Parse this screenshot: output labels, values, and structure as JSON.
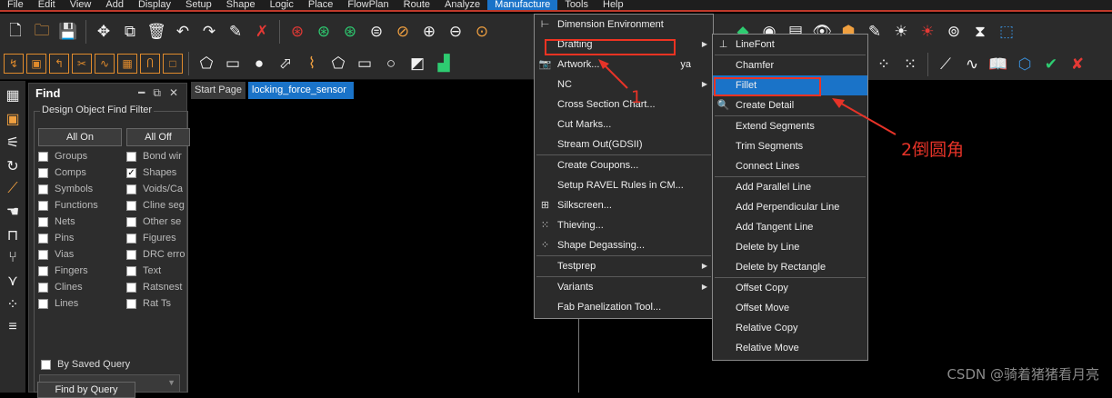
{
  "menubar": {
    "items": [
      "File",
      "Edit",
      "View",
      "Add",
      "Display",
      "Setup",
      "Shape",
      "Logic",
      "Place",
      "FlowPlan",
      "Route",
      "Analyze",
      "Manufacture",
      "Tools",
      "Help"
    ],
    "active": "Manufacture"
  },
  "tabs": [
    {
      "label": "Start Page"
    },
    {
      "label": "locking_force_sensor"
    }
  ],
  "find_panel": {
    "title": "Find",
    "group_label": "Design Object Find Filter",
    "all_on": "All On",
    "all_off": "All Off",
    "left_items": [
      {
        "label": "Groups",
        "checked": false
      },
      {
        "label": "Comps",
        "checked": false
      },
      {
        "label": "Symbols",
        "checked": false
      },
      {
        "label": "Functions",
        "checked": false
      },
      {
        "label": "Nets",
        "checked": false
      },
      {
        "label": "Pins",
        "checked": false
      },
      {
        "label": "Vias",
        "checked": false
      },
      {
        "label": "Fingers",
        "checked": false
      },
      {
        "label": "Clines",
        "checked": false
      },
      {
        "label": "Lines",
        "checked": false
      }
    ],
    "right_items": [
      {
        "label": "Bond wir",
        "checked": false
      },
      {
        "label": "Shapes",
        "checked": true
      },
      {
        "label": "Voids/Ca",
        "checked": false
      },
      {
        "label": "Cline seg",
        "checked": false
      },
      {
        "label": "Other se",
        "checked": false
      },
      {
        "label": "Figures",
        "checked": false
      },
      {
        "label": "DRC erro",
        "checked": false
      },
      {
        "label": "Text",
        "checked": false
      },
      {
        "label": "Ratsnest",
        "checked": false
      },
      {
        "label": "Rat Ts",
        "checked": false
      }
    ],
    "saved_query_label": "By Saved Query",
    "find_by_query": "Find by Query"
  },
  "manufacture_menu": {
    "items": [
      {
        "label": "Dimension Environment",
        "icon": "dimension-icon"
      },
      {
        "label": "Drafting",
        "submenu": true,
        "highlight": true
      },
      {
        "label": "Artwork...",
        "icon": "camera-icon",
        "suffix": "ya"
      },
      {
        "label": "NC",
        "submenu": true
      },
      {
        "label": "Cross Section Chart..."
      },
      {
        "label": "Cut Marks..."
      },
      {
        "label": "Stream Out(GDSII)"
      },
      {
        "label": "Create Coupons..."
      },
      {
        "label": "Setup RAVEL Rules in CM..."
      },
      {
        "label": "Silkscreen...",
        "icon": "silkscreen-icon"
      },
      {
        "label": "Thieving...",
        "icon": "thieving-icon"
      },
      {
        "label": "Shape Degassing...",
        "icon": "degassing-icon"
      },
      {
        "label": "Testprep",
        "submenu": true
      },
      {
        "label": "Variants",
        "submenu": true
      },
      {
        "label": "Fab Panelization Tool..."
      }
    ]
  },
  "drafting_menu": {
    "items": [
      {
        "label": "LineFont",
        "icon": "linefont-icon"
      },
      {
        "label": "Chamfer"
      },
      {
        "label": "Fillet",
        "highlight": true
      },
      {
        "label": "Create Detail",
        "icon": "detail-icon"
      },
      {
        "label": "Extend Segments"
      },
      {
        "label": "Trim Segments"
      },
      {
        "label": "Connect Lines"
      },
      {
        "label": "Add Parallel Line"
      },
      {
        "label": "Add Perpendicular Line"
      },
      {
        "label": "Add Tangent Line"
      },
      {
        "label": "Delete by Line"
      },
      {
        "label": "Delete by Rectangle"
      },
      {
        "label": "Offset Copy"
      },
      {
        "label": "Offset Move"
      },
      {
        "label": "Relative Copy"
      },
      {
        "label": "Relative Move"
      }
    ]
  },
  "annotations": {
    "step1": "1",
    "step2": "2倒圆角",
    "color": "#e63328"
  },
  "watermark": "CSDN @骑着猪猪看月亮"
}
